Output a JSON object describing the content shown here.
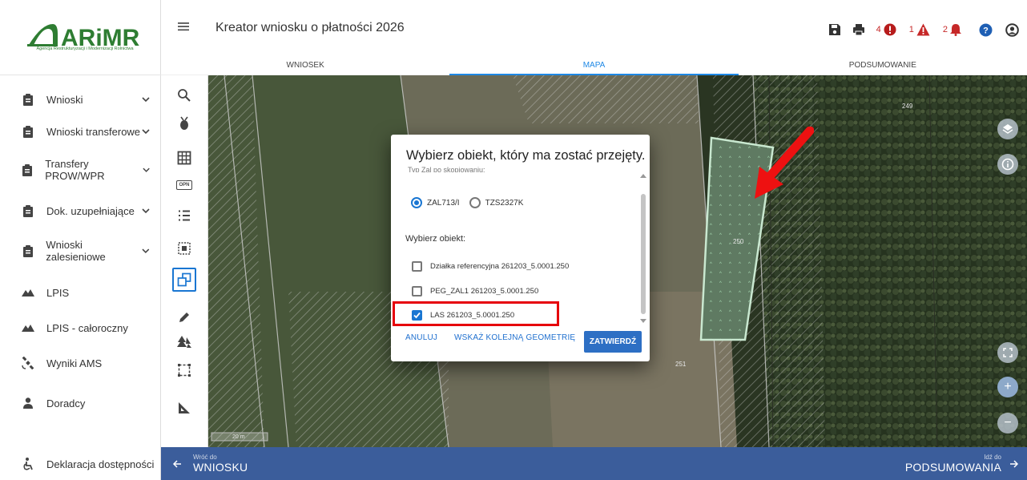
{
  "logo": {
    "text": "ARiMR",
    "subtitle": "Agencja Restrukturyzacji i Modernizacji Rolnictwa"
  },
  "header": {
    "title": "Kreator wniosku o płatności 2026",
    "counts": {
      "errors": "4",
      "warnings": "1",
      "notices": "2"
    }
  },
  "tabs": [
    {
      "label": "WNIOSEK"
    },
    {
      "label": "MAPA"
    },
    {
      "label": "PODSUMOWANIE"
    }
  ],
  "active_tab": "MAPA",
  "sidebar": {
    "items": [
      {
        "label": "Wnioski",
        "icon": "clipboard-icon"
      },
      {
        "label": "Wnioski transferowe",
        "icon": "clipboard-icon"
      },
      {
        "label": "Transfery PROW/WPR",
        "icon": "clipboard-icon"
      },
      {
        "label": "Dok. uzupełniające",
        "icon": "clipboard-icon"
      },
      {
        "label": "Wnioski zalesieniowe",
        "icon": "clipboard-icon"
      },
      {
        "label": "LPIS",
        "icon": "terrain-icon"
      },
      {
        "label": "LPIS - całoroczny",
        "icon": "terrain-icon"
      },
      {
        "label": "Wyniki AMS",
        "icon": "satellite-icon"
      },
      {
        "label": "Doradcy",
        "icon": "person-icon"
      },
      {
        "label": "Deklaracja dostępności",
        "icon": "accessibility-icon"
      }
    ]
  },
  "toolrail": {
    "opn_label": "OPN"
  },
  "map": {
    "labels": {
      "p249": "249",
      "p250": "250",
      "p240": "240",
      "p251": "251"
    },
    "scale": "20 m"
  },
  "modal": {
    "title": "Wybierz obiekt, który ma zostać przejęty.",
    "cut_text": "Typ Zal po skopiowaniu:",
    "radio_options": [
      "ZAL713/I",
      "TZS2327K"
    ],
    "selected_radio": "ZAL713/I",
    "object_label": "Wybierz obiekt:",
    "objects": [
      {
        "label": "Działka referencyjna 261203_5.0001.250",
        "checked": false
      },
      {
        "label": "PEG_ZAL1 261203_5.0001.250",
        "checked": false
      },
      {
        "label": "LAS 261203_5.0001.250",
        "checked": true
      }
    ],
    "buttons": {
      "cancel": "ANULUJ",
      "next_geometry": "WSKAŻ KOLEJNĄ GEOMETRIĘ",
      "confirm": "ZATWIERDŹ"
    }
  },
  "footer": {
    "back_small": "Wróć do",
    "back_big": "WNIOSKU",
    "next_small": "Idź do",
    "next_big": "PODSUMOWANIA"
  },
  "colors": {
    "accent": "#1e88e5",
    "footer": "#3b5d9b",
    "logo_green": "#2e7d32",
    "highlight": "#e6000b",
    "error": "#c62828"
  }
}
